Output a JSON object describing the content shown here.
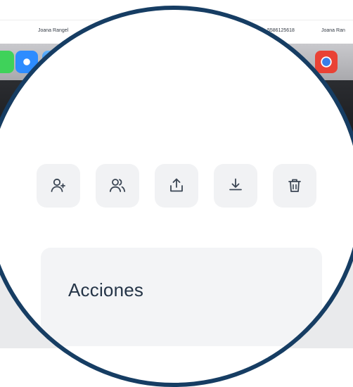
{
  "background": {
    "table_row": {
      "name_left": "Joana Rangel",
      "phone": "5586125618",
      "name_right": "Joana Ran"
    },
    "dock_icons": [
      "messages-icon",
      "safari-icon",
      "mail-icon",
      "chrome-icon"
    ]
  },
  "toolbar": {
    "actions": [
      {
        "icon": "add-user-icon"
      },
      {
        "icon": "users-icon"
      },
      {
        "icon": "upload-icon"
      },
      {
        "icon": "download-icon"
      },
      {
        "icon": "trash-icon"
      }
    ]
  },
  "panel": {
    "title": "Acciones"
  },
  "colors": {
    "ring": "#163d63",
    "button_bg": "#f1f2f4",
    "panel_bg": "#f3f4f6",
    "icon_stroke": "#3b4654",
    "title_text": "#243447"
  }
}
